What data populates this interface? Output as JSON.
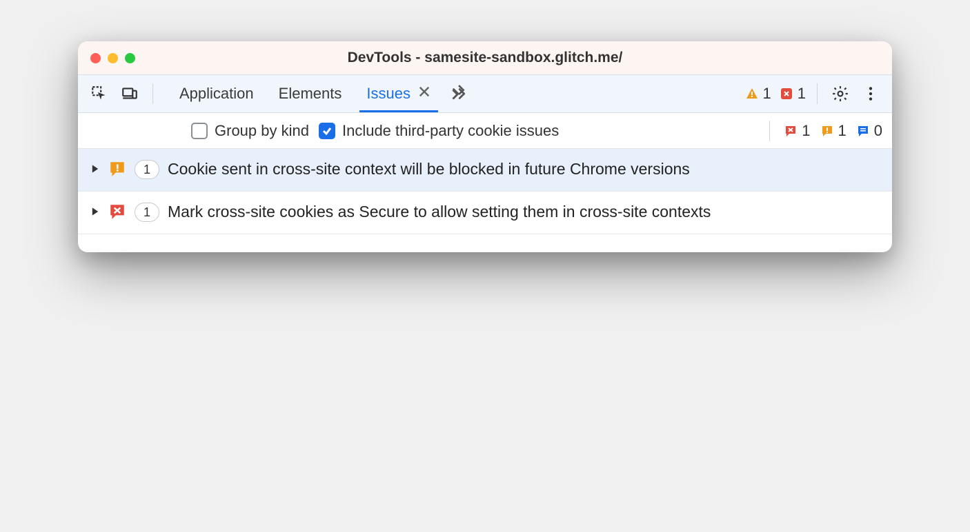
{
  "window": {
    "title": "DevTools - samesite-sandbox.glitch.me/"
  },
  "tabs": {
    "application": "Application",
    "elements": "Elements",
    "issues": "Issues"
  },
  "toolbar_counts": {
    "warning": "1",
    "error": "1"
  },
  "filters": {
    "group_by_kind": "Group by kind",
    "include_third_party": "Include third-party cookie issues"
  },
  "filter_counts": {
    "error": "1",
    "warning": "1",
    "info": "0"
  },
  "issues": [
    {
      "count": "1",
      "kind": "warning",
      "title": "Cookie sent in cross-site context will be blocked in future Chrome versions"
    },
    {
      "count": "1",
      "kind": "error",
      "title": "Mark cross-site cookies as Secure to allow setting them in cross-site contexts"
    }
  ],
  "colors": {
    "accent": "#1a6fe8",
    "warning": "#f09a1a",
    "error": "#e24b3e",
    "info": "#1a6fe8"
  }
}
